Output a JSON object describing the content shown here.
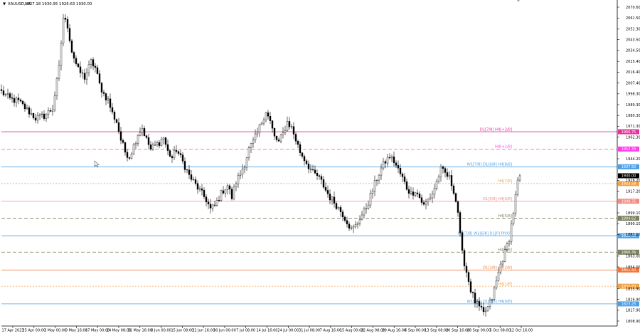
{
  "header": {
    "symbol": "XAUUSD,H4",
    "ohlc": "1927.18 1930.95 1926.63 1930.00"
  },
  "chart_data": {
    "type": "candlestick",
    "symbol": "XAUUSD",
    "timeframe": "H4",
    "ylim": [
      1804.0,
      2075.0
    ],
    "x_tick_labels": [
      "17 Apr 2023",
      "25 Apr 00:00",
      "2 May 00:00",
      "9 May 16:00",
      "17 May 00:00",
      "24 May 08:00",
      "31 May 16:00",
      "8 Jun 00:00",
      "15 Jun 08:00",
      "22 Jun 16:00",
      "30 Jun 00:00",
      "7 Jul 08:00",
      "14 Jul 16:00",
      "24 Jul 00:00",
      "31 Jul 08:00",
      "7 Aug 16:00",
      "15 Aug 00:00",
      "22 Aug 08:00",
      "29 Aug 16:00",
      "6 Sep 00:00",
      "13 Sep 08:00",
      "20 Sep 16:00",
      "28 Sep 00:00",
      "5 Oct 08:00",
      "12 Oct 16:00"
    ],
    "y_ticks": [
      "2070.60",
      "2061.50",
      "2052.30",
      "2043.50",
      "2034.50",
      "2025.40",
      "2016.40",
      "2007.40",
      "1998.30",
      "1989.30",
      "1980.30",
      "1971.30",
      "1962.30",
      "1944.20",
      "1926.20",
      "1917.20",
      "1899.10",
      "1890.10",
      "1881.10",
      "1863.00",
      "1854.00",
      "1835.90",
      "1826.90",
      "1817.90",
      "1808.90"
    ],
    "price_path": [
      [
        0,
        2000
      ],
      [
        4,
        1994
      ],
      [
        8,
        1992
      ],
      [
        12,
        1985
      ],
      [
        16,
        1978
      ],
      [
        20,
        1980
      ],
      [
        24,
        1986
      ],
      [
        27,
        2020
      ],
      [
        29,
        2062
      ],
      [
        31,
        2055
      ],
      [
        33,
        2034
      ],
      [
        36,
        2018
      ],
      [
        39,
        2012
      ],
      [
        42,
        2025
      ],
      [
        44,
        2020
      ],
      [
        46,
        2006
      ],
      [
        48,
        1998
      ],
      [
        50,
        1993
      ],
      [
        52,
        1982
      ],
      [
        54,
        1975
      ],
      [
        56,
        1960
      ],
      [
        58,
        1950
      ],
      [
        60,
        1946
      ],
      [
        62,
        1955
      ],
      [
        64,
        1965
      ],
      [
        66,
        1970
      ],
      [
        68,
        1960
      ],
      [
        70,
        1952
      ],
      [
        72,
        1955
      ],
      [
        74,
        1958
      ],
      [
        76,
        1962
      ],
      [
        78,
        1950
      ],
      [
        80,
        1945
      ],
      [
        82,
        1952
      ],
      [
        84,
        1945
      ],
      [
        86,
        1938
      ],
      [
        88,
        1930
      ],
      [
        90,
        1925
      ],
      [
        92,
        1920
      ],
      [
        94,
        1915
      ],
      [
        96,
        1910
      ],
      [
        98,
        1902
      ],
      [
        100,
        1905
      ],
      [
        102,
        1912
      ],
      [
        104,
        1918
      ],
      [
        106,
        1922
      ],
      [
        108,
        1912
      ],
      [
        110,
        1925
      ],
      [
        112,
        1932
      ],
      [
        114,
        1940
      ],
      [
        116,
        1952
      ],
      [
        118,
        1958
      ],
      [
        120,
        1966
      ],
      [
        122,
        1975
      ],
      [
        124,
        1984
      ],
      [
        126,
        1975
      ],
      [
        128,
        1962
      ],
      [
        130,
        1958
      ],
      [
        132,
        1965
      ],
      [
        134,
        1975
      ],
      [
        136,
        1970
      ],
      [
        138,
        1960
      ],
      [
        140,
        1950
      ],
      [
        142,
        1944
      ],
      [
        144,
        1938
      ],
      [
        146,
        1932
      ],
      [
        148,
        1930
      ],
      [
        150,
        1925
      ],
      [
        152,
        1918
      ],
      [
        154,
        1912
      ],
      [
        156,
        1908
      ],
      [
        158,
        1903
      ],
      [
        160,
        1898
      ],
      [
        162,
        1892
      ],
      [
        164,
        1885
      ],
      [
        166,
        1888
      ],
      [
        168,
        1895
      ],
      [
        170,
        1900
      ],
      [
        172,
        1908
      ],
      [
        174,
        1918
      ],
      [
        176,
        1928
      ],
      [
        178,
        1936
      ],
      [
        180,
        1942
      ],
      [
        182,
        1946
      ],
      [
        184,
        1942
      ],
      [
        186,
        1935
      ],
      [
        188,
        1928
      ],
      [
        190,
        1920
      ],
      [
        192,
        1915
      ],
      [
        194,
        1918
      ],
      [
        196,
        1912
      ],
      [
        198,
        1905
      ],
      [
        200,
        1910
      ],
      [
        202,
        1915
      ],
      [
        204,
        1925
      ],
      [
        206,
        1935
      ],
      [
        208,
        1932
      ],
      [
        210,
        1928
      ],
      [
        212,
        1918
      ],
      [
        214,
        1900
      ],
      [
        215,
        1880
      ],
      [
        216,
        1865
      ],
      [
        218,
        1850
      ],
      [
        220,
        1835
      ],
      [
        222,
        1825
      ],
      [
        224,
        1820
      ],
      [
        226,
        1815
      ],
      [
        228,
        1820
      ],
      [
        230,
        1828
      ],
      [
        232,
        1842
      ],
      [
        234,
        1856
      ],
      [
        236,
        1866
      ],
      [
        238,
        1878
      ],
      [
        240,
        1900
      ],
      [
        242,
        1925
      ],
      [
        243,
        1930
      ]
    ],
    "levels": [
      {
        "price": 1966.7,
        "label": "D1[7/8] H4[+2/8]",
        "color": "#e8309a",
        "dash": "solid",
        "tag": "1966.75"
      },
      {
        "price": 1952.3,
        "label": "H4[+1/8]",
        "color": "#ff3ee8",
        "dash": "dashed",
        "tag": "1952.33"
      },
      {
        "price": 1937.5,
        "label": "W1[7/8] D1[6/8] H4[8/8]",
        "color": "#4aa0e6",
        "dash": "solid",
        "tag": "1937.50"
      },
      {
        "price": 1923.5,
        "label": "H4[7/8]",
        "color": "#f0a24a",
        "dash": "dotted",
        "tag": "1923.58"
      },
      {
        "price": 1908.8,
        "label": "D1[5/8] H4[6/8]",
        "color": "#f28b82",
        "dash": "solid",
        "tag": "1908.75"
      },
      {
        "price": 1894.6,
        "label": "H4[5/8]",
        "color": "#7b8060",
        "dash": "dashed",
        "tag": "1894.62"
      },
      {
        "price": 1880.0,
        "label": "W1[7/8] W1[6/8] D1[P] PIVOT",
        "color": "#4aa0e6",
        "dash": "solid",
        "tag": "1880.00"
      },
      {
        "price": 1866.3,
        "label": "H4[3/8]",
        "color": "#7b8060",
        "dash": "dashed",
        "tag": "1866.36"
      },
      {
        "price": 1851.5,
        "label": "D1[3/8] H4[2/8]",
        "color": "#f0763a",
        "dash": "solid",
        "tag": "1851.50"
      },
      {
        "price": 1837.9,
        "label": "H4[1/8]",
        "color": "#f0a24a",
        "dash": "dotted",
        "tag": "1837.83"
      },
      {
        "price": 1823.2,
        "label": "W1[5/8] D1[2/8] H4[0/8]",
        "color": "#4aa0e6",
        "dash": "solid",
        "tag": "1823.25"
      }
    ],
    "current_price": {
      "price": 1930.0,
      "tag": "1930.00"
    }
  },
  "colors": {
    "background": "#ffffff",
    "candles": "#000000",
    "axis": "#000000",
    "text": "#000000"
  }
}
